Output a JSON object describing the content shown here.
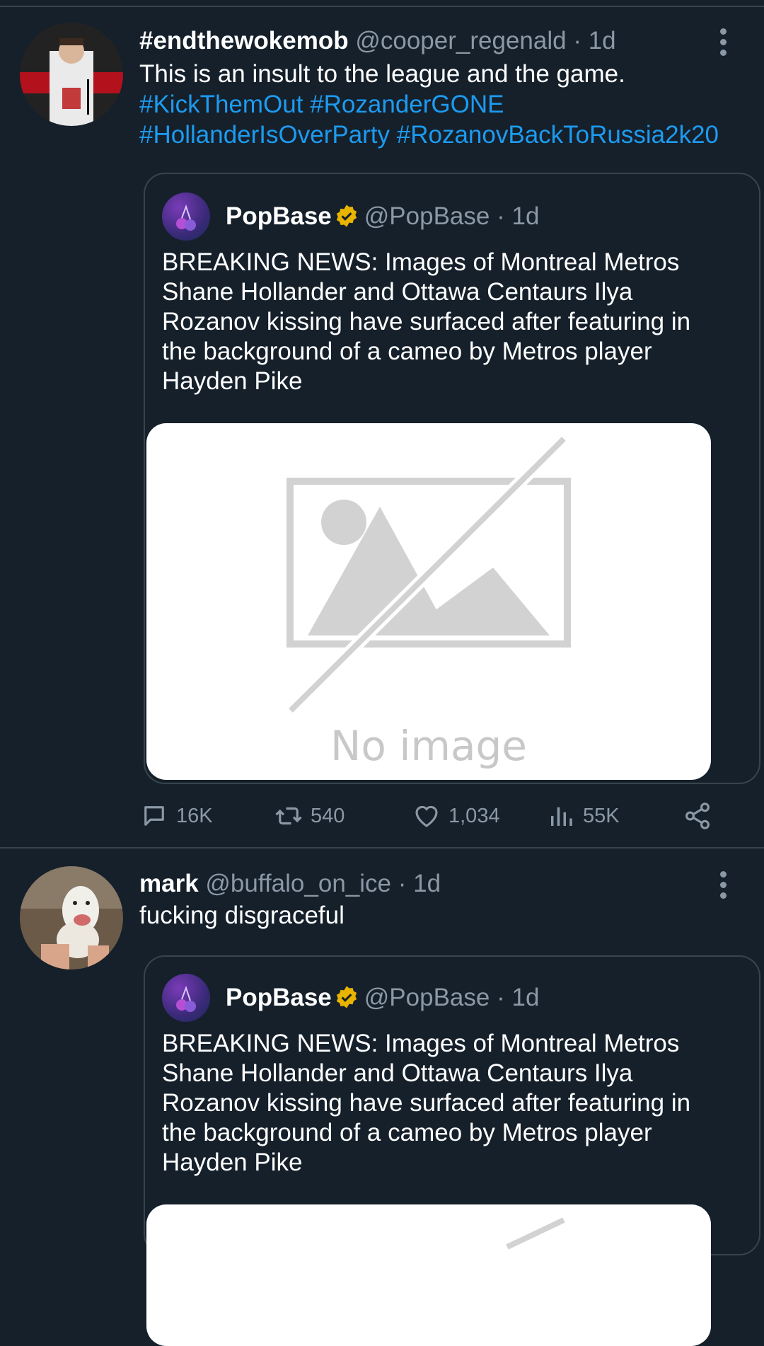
{
  "tweets": [
    {
      "display_name": "#endthewokemob",
      "handle": "@cooper_regenald",
      "time": "· 1d",
      "text": "This is an insult to the league and the game.",
      "hashtags_line1": "#KickThemOut #RozanderGONE",
      "hashtags_line2": "#HollanderIsOverParty #RozanovBackToRussia2k20",
      "quote": {
        "display_name": "PopBase",
        "handle": "@PopBase",
        "time": "· 1d",
        "text": "BREAKING NEWS: Images of Montreal Metros Shane Hollander and Ottawa Centaurs Ilya Rozanov kissing have surfaced after featuring in the background of a cameo by Metros player Hayden Pike",
        "media_placeholder": "No image"
      },
      "actions": {
        "replies": "16K",
        "retweets": "540",
        "likes": "1,034",
        "views": "55K"
      }
    },
    {
      "display_name": "mark",
      "handle": "@buffalo_on_ice",
      "time": "· 1d",
      "text": "fucking disgraceful",
      "quote": {
        "display_name": "PopBase",
        "handle": "@PopBase",
        "time": "· 1d",
        "text": "BREAKING NEWS: Images of Montreal Metros Shane Hollander and Ottawa Centaurs Ilya Rozanov kissing have surfaced after featuring in the background of a cameo by Metros player Hayden Pike"
      }
    }
  ],
  "icons": {
    "reply": "reply-icon",
    "retweet": "retweet-icon",
    "like": "heart-icon",
    "views": "views-icon",
    "share": "share-icon",
    "verified": "verified-badge-icon",
    "more": "more-vertical-icon"
  },
  "colors": {
    "background": "#15202b",
    "link": "#1d9bf0",
    "muted": "#8b98a5",
    "verified": "#e8b400"
  }
}
